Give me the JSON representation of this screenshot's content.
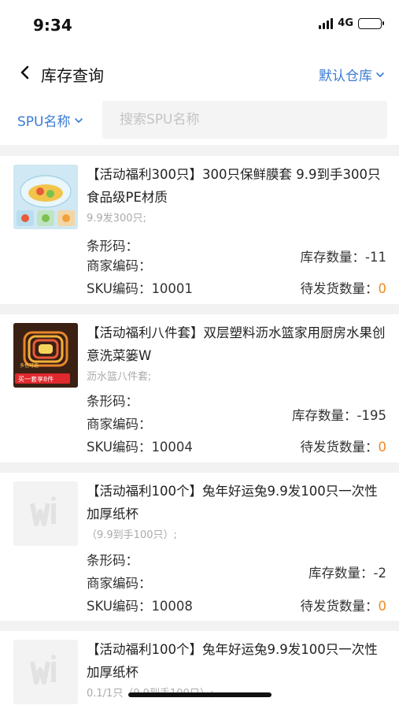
{
  "status_bar": {
    "time": "9:34",
    "network": "4G"
  },
  "nav": {
    "title": "库存查询",
    "warehouse_label": "默认仓库"
  },
  "search": {
    "field_label": "SPU名称",
    "placeholder": "搜索SPU名称"
  },
  "field_labels": {
    "barcode": "条形码：",
    "merchant_code": "商家编码：",
    "sku_code": "SKU编码：",
    "stock_qty": "库存数量：",
    "pending_qty": "待发货数量："
  },
  "products": [
    {
      "title": "【活动福利300只】300只保鲜膜套 9.9到手300只食品级PE材质",
      "subtitle": "9.9发300只;",
      "sku": "10001",
      "stock": "-11",
      "pending": "0",
      "image": "cling-wrap-bowls"
    },
    {
      "title": "【活动福利八件套】双层塑料沥水篮家用厨房水果创意洗菜篓W",
      "subtitle": "沥水篮八件套;",
      "sku": "10004",
      "stock": "-195",
      "pending": "0",
      "image": "drain-basket-set",
      "image_text_top": "多色可选",
      "image_text_bottom": "买一套享8件"
    },
    {
      "title": "【活动福利100个】兔年好运兔9.9发100只一次性加厚纸杯",
      "subtitle": "（9.9到手100只）;",
      "sku": "10008",
      "stock": "-2",
      "pending": "0",
      "image": "placeholder-logo"
    },
    {
      "title": "【活动福利100个】兔年好运兔9.9发100只一次性加厚纸杯",
      "subtitle": "0.1/1只（9.9到手100只）;",
      "image": "placeholder-logo"
    }
  ],
  "colors": {
    "accent": "#3a7bd5",
    "pending": "#f08a24",
    "muted": "#aaaaaa",
    "background": "#f2f2f2"
  }
}
